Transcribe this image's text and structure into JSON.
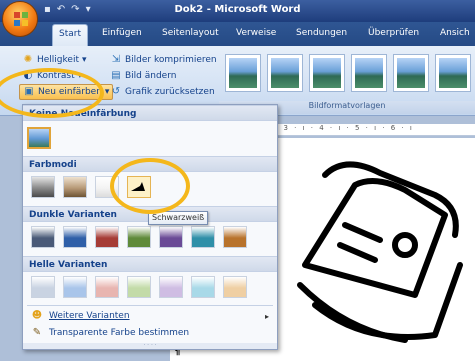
{
  "window": {
    "title": "Dok2 - Microsoft Word",
    "qat_icons": [
      "save-icon",
      "undo-icon",
      "redo-icon",
      "customize-icon"
    ]
  },
  "tabs": [
    "Start",
    "Einfügen",
    "Seitenlayout",
    "Verweise",
    "Sendungen",
    "Überprüfen",
    "Ansich"
  ],
  "ribbon": {
    "brightness": "Helligkeit",
    "contrast": "Kontrast",
    "recolor": "Neu einfärben",
    "compress": "Bilder komprimieren",
    "change": "Bild ändern",
    "reset": "Grafik zurücksetzen",
    "group_label": "Bildformatvorlagen"
  },
  "ruler": "· 3 · ı · 4 · ı · 5 · ı · 6 · ı",
  "dropdown": {
    "section_none": "Keine Neueinfärbung",
    "section_modes": "Farbmodi",
    "section_dark": "Dunkle Varianten",
    "section_light": "Helle Varianten",
    "more_variants": "Weitere Varianten",
    "transparent": "Transparente Farbe bestimmen",
    "tooltip": "Schwarzweiß"
  },
  "colors": {
    "highlight": "#f4b71b",
    "ribbon_text": "#15428b",
    "dark_variants": [
      "#4a5a78",
      "#2f5fa8",
      "#a63c36",
      "#5f8a3a",
      "#6a4a96",
      "#2f8fa8",
      "#b8732c"
    ],
    "light_variants": [
      "#c9d3e2",
      "#a9c5ea",
      "#e8b5b0",
      "#c3dba8",
      "#cfbde3",
      "#a8d9e8",
      "#efcfa3"
    ]
  },
  "paragraph_mark": "¶"
}
